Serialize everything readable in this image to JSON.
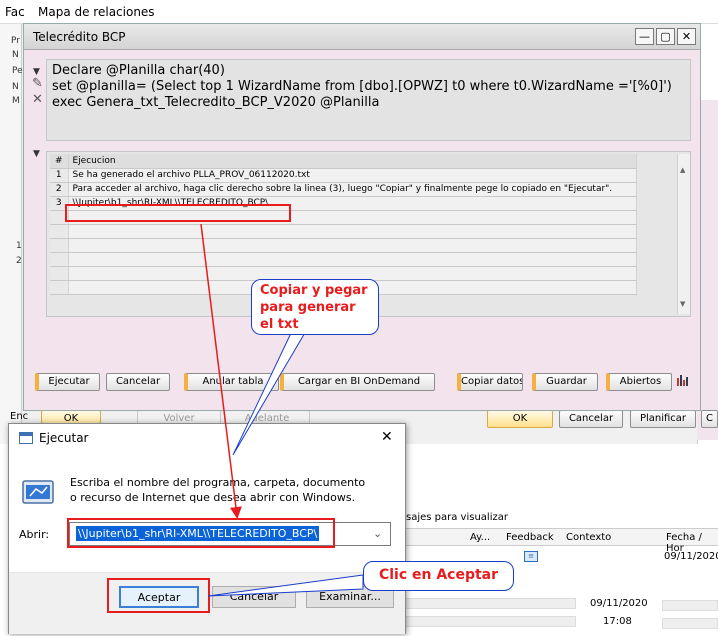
{
  "background_window": {
    "menu": [
      "Fac",
      "Mapa de relaciones"
    ],
    "left_labels": [
      "Pr",
      "N",
      "Pe",
      "N",
      "M",
      "1",
      "2",
      "Enc"
    ],
    "buttons": {
      "ok": "OK",
      "volver": "Volver",
      "adelante": "Adelante"
    },
    "right_buttons": {
      "ok": "OK",
      "cancelar": "Cancelar",
      "planificar": "Planificar",
      "more": "C"
    },
    "log_hint": "sajes para visualizar",
    "log_columns": [
      "Ay...",
      "Feedback",
      "Contexto",
      "Fecha / Hor"
    ],
    "log_rows": [
      {
        "date": "09/11/2020"
      },
      {
        "date": "09/11/2020"
      },
      {
        "date": "17:08"
      }
    ]
  },
  "telecredito_window": {
    "title": "Telecrédito BCP",
    "window_buttons": {
      "minimize": "—",
      "maximize": "▢",
      "close": "✕"
    },
    "sql_lines": [
      "Declare @Planilla char(40)",
      "set @planilla= (Select top 1 WizardName from [dbo].[OPWZ] t0 where t0.WizardName ='[%0]')",
      "exec Genera_txt_Telecredito_BCP_V2020  @Planilla"
    ],
    "results": {
      "col_num": "#",
      "col_name": "Ejecucion",
      "rows": [
        {
          "n": "1",
          "v": "Se ha generado el archivo PLLA_PROV_06112020.txt"
        },
        {
          "n": "2",
          "v": "Para acceder al archivo, haga clic derecho sobre la linea (3), luego \"Copiar\" y finalmente pege lo copiado en \"Ejecutar\"."
        },
        {
          "n": "3",
          "v": "\\\\Jupiter\\b1_shr\\RI-XML\\\\TELECREDITO_BCP\\"
        }
      ]
    },
    "buttons": {
      "ejecutar": "Ejecutar",
      "cancelar": "Cancelar",
      "anular_tabla": "Anular tabla",
      "cargar_bi": "Cargar en BI OnDemand",
      "copiar_datos": "Copiar datos",
      "guardar": "Guardar",
      "abiertos": "Abiertos"
    }
  },
  "run_dialog": {
    "title": "Ejecutar",
    "close": "✕",
    "description": "Escriba el nombre del programa, carpeta, documento o recurso de Internet que desea abrir con Windows.",
    "open_label": "Abrir:",
    "open_value": "\\\\Jupiter\\b1_shr\\RI-XML\\\\TELECREDITO_BCP\\",
    "buttons": {
      "aceptar": "Aceptar",
      "cancelar": "Cancelar",
      "examinar": "Examinar..."
    }
  },
  "annotations": {
    "copy_callout": "Copiar y pegar para generar el txt",
    "accept_callout": "Clic en Aceptar"
  },
  "colors": {
    "annotation_red": "#e81c1c",
    "callout_border": "#1a3ec9",
    "window_pink": "#f3e3ec",
    "selection_blue": "#0a64d8"
  }
}
